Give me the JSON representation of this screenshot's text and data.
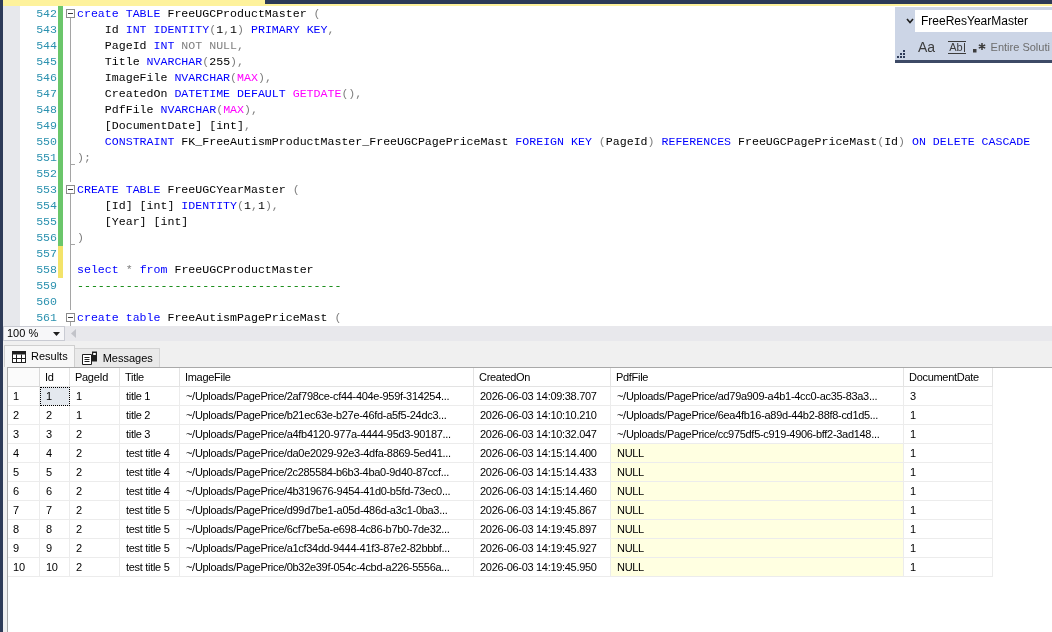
{
  "editor": {
    "lines": [
      {
        "number": "542",
        "color": "#6bc66b",
        "kind": "header",
        "tokens": [
          {
            "text": "create TABLE",
            "kind": "keyword"
          },
          {
            "text": " FreeUGCProductMaster ",
            "kind": "plain"
          },
          {
            "text": "(",
            "kind": "punct"
          }
        ]
      },
      {
        "number": "543",
        "color": "#6bc66b",
        "kind": "body",
        "tokens": [
          {
            "text": "    Id ",
            "kind": "plain"
          },
          {
            "text": "INT IDENTITY",
            "kind": "keyword"
          },
          {
            "text": "(",
            "kind": "punct"
          },
          {
            "text": "1",
            "kind": "plain"
          },
          {
            "text": ",",
            "kind": "punct"
          },
          {
            "text": "1",
            "kind": "plain"
          },
          {
            "text": ") ",
            "kind": "punct"
          },
          {
            "text": "PRIMARY KEY",
            "kind": "keyword"
          },
          {
            "text": ",",
            "kind": "punct"
          }
        ]
      },
      {
        "number": "544",
        "color": "#6bc66b",
        "kind": "body",
        "tokens": [
          {
            "text": "    PageId ",
            "kind": "plain"
          },
          {
            "text": "INT",
            "kind": "keyword"
          },
          {
            "text": " NOT NULL,",
            "kind": "punct"
          }
        ]
      },
      {
        "number": "545",
        "color": "#6bc66b",
        "kind": "body",
        "tokens": [
          {
            "text": "    Title ",
            "kind": "plain"
          },
          {
            "text": "NVARCHAR",
            "kind": "keyword"
          },
          {
            "text": "(",
            "kind": "punct"
          },
          {
            "text": "255",
            "kind": "plain"
          },
          {
            "text": "),",
            "kind": "punct"
          }
        ]
      },
      {
        "number": "546",
        "color": "#6bc66b",
        "kind": "body",
        "tokens": [
          {
            "text": "    ImageFile ",
            "kind": "plain"
          },
          {
            "text": "NVARCHAR",
            "kind": "keyword"
          },
          {
            "text": "(",
            "kind": "punct"
          },
          {
            "text": "MAX",
            "kind": "function"
          },
          {
            "text": "),",
            "kind": "punct"
          }
        ]
      },
      {
        "number": "547",
        "color": "#6bc66b",
        "kind": "body",
        "tokens": [
          {
            "text": "    CreatedOn ",
            "kind": "plain"
          },
          {
            "text": "DATETIME DEFAULT ",
            "kind": "keyword"
          },
          {
            "text": "GETDATE",
            "kind": "function"
          },
          {
            "text": "(),",
            "kind": "punct"
          }
        ]
      },
      {
        "number": "548",
        "color": "#6bc66b",
        "kind": "body",
        "tokens": [
          {
            "text": "    PdfFile ",
            "kind": "plain"
          },
          {
            "text": "NVARCHAR",
            "kind": "keyword"
          },
          {
            "text": "(",
            "kind": "punct"
          },
          {
            "text": "MAX",
            "kind": "function"
          },
          {
            "text": "),",
            "kind": "punct"
          }
        ]
      },
      {
        "number": "549",
        "color": "#6bc66b",
        "kind": "body",
        "tokens": [
          {
            "text": "    [DocumentDate] [int]",
            "kind": "plain"
          },
          {
            "text": ",",
            "kind": "punct"
          }
        ]
      },
      {
        "number": "550",
        "color": "#6bc66b",
        "kind": "body",
        "tokens": [
          {
            "text": "    CONSTRAINT",
            "kind": "keyword"
          },
          {
            "text": " FK_FreeAutismProductMaster_FreeUGCPagePriceMast ",
            "kind": "plain"
          },
          {
            "text": "FOREIGN KEY ",
            "kind": "keyword"
          },
          {
            "text": "(",
            "kind": "punct"
          },
          {
            "text": "PageId",
            "kind": "plain"
          },
          {
            "text": ") ",
            "kind": "punct"
          },
          {
            "text": "REFERENCES",
            "kind": "keyword"
          },
          {
            "text": " FreeUGCPagePriceMast",
            "kind": "plain"
          },
          {
            "text": "(",
            "kind": "punct"
          },
          {
            "text": "Id",
            "kind": "plain"
          },
          {
            "text": ") ",
            "kind": "punct"
          },
          {
            "text": "ON DELETE CASCADE",
            "kind": "keyword"
          }
        ]
      },
      {
        "number": "551",
        "color": "#6bc66b",
        "kind": "closer",
        "tokens": [
          {
            "text": ");",
            "kind": "punct"
          }
        ]
      },
      {
        "number": "552",
        "color": "#6bc66b",
        "kind": "body"
      },
      {
        "number": "553",
        "color": "#6bc66b",
        "kind": "header",
        "tokens": [
          {
            "text": "CREATE TABLE",
            "kind": "keyword"
          },
          {
            "text": " FreeUGCYearMaster ",
            "kind": "plain"
          },
          {
            "text": "(",
            "kind": "punct"
          }
        ]
      },
      {
        "number": "554",
        "color": "#6bc66b",
        "kind": "body",
        "tokens": [
          {
            "text": "    [Id] [int] ",
            "kind": "plain"
          },
          {
            "text": "IDENTITY",
            "kind": "keyword"
          },
          {
            "text": "(",
            "kind": "punct"
          },
          {
            "text": "1",
            "kind": "plain"
          },
          {
            "text": ",",
            "kind": "punct"
          },
          {
            "text": "1",
            "kind": "plain"
          },
          {
            "text": "),",
            "kind": "punct"
          }
        ]
      },
      {
        "number": "555",
        "color": "#6bc66b",
        "kind": "body",
        "tokens": [
          {
            "text": "    [Year] [int]",
            "kind": "plain"
          }
        ]
      },
      {
        "number": "556",
        "color": "#6bc66b",
        "kind": "closer",
        "tokens": [
          {
            "text": ")",
            "kind": "punct"
          }
        ]
      },
      {
        "number": "557",
        "color": "#f3e36a",
        "kind": "body"
      },
      {
        "number": "558",
        "color": "#f3e36a",
        "kind": "body",
        "tokens": [
          {
            "text": "select",
            "kind": "keyword"
          },
          {
            "text": " * ",
            "kind": "punct"
          },
          {
            "text": "from",
            "kind": "keyword"
          },
          {
            "text": " FreeUGCProductMaster",
            "kind": "plain"
          }
        ]
      },
      {
        "number": "559",
        "kind": "body",
        "tokens": [
          {
            "text": "--------------------------------------",
            "kind": "comment"
          }
        ]
      },
      {
        "number": "560",
        "kind": "body"
      },
      {
        "number": "561",
        "kind": "header",
        "tokens": [
          {
            "text": "create table",
            "kind": "keyword"
          },
          {
            "text": " FreeAutismPagePriceMast ",
            "kind": "plain"
          },
          {
            "text": "(",
            "kind": "punct"
          }
        ]
      }
    ]
  },
  "find_widget": {
    "query": "FreeResYearMaster",
    "match_case": "Aa",
    "whole_word": "Ab",
    "scope": "Entire Soluti"
  },
  "zoom": "100 %",
  "results": {
    "tabs": [
      {
        "kind": "grid",
        "label": "Results",
        "selected": true
      },
      {
        "kind": "messages",
        "label": "Messages",
        "selected": false
      }
    ],
    "columns": [
      "Id",
      "PageId",
      "Title",
      "ImageFile",
      "CreatedOn",
      "PdfFile",
      "DocumentDate"
    ],
    "rows": [
      {
        "number": "1",
        "cells": [
          {
            "text": "1",
            "kind": "value",
            "selected": true
          },
          {
            "text": "1",
            "kind": "value",
            "selected": false
          },
          {
            "text": "title 1",
            "kind": "value",
            "selected": false
          },
          {
            "text": "~/Uploads/PagePrice/2af798ce-cf44-404e-959f-314254...",
            "kind": "value",
            "selected": false
          },
          {
            "text": "2026-06-03 14:09:38.707",
            "kind": "value",
            "selected": false
          },
          {
            "text": "~/Uploads/PagePrice/ad79a909-a4b1-4cc0-ac35-83a3...",
            "kind": "value",
            "selected": false
          },
          {
            "text": "3",
            "kind": "value",
            "selected": false
          }
        ]
      },
      {
        "number": "2",
        "cells": [
          {
            "text": "2",
            "kind": "value",
            "selected": false
          },
          {
            "text": "1",
            "kind": "value",
            "selected": false
          },
          {
            "text": "title 2",
            "kind": "value",
            "selected": false
          },
          {
            "text": "~/Uploads/PagePrice/b21ec63e-b27e-46fd-a5f5-24dc3...",
            "kind": "value",
            "selected": false
          },
          {
            "text": "2026-06-03 14:10:10.210",
            "kind": "value",
            "selected": false
          },
          {
            "text": "~/Uploads/PagePrice/6ea4fb16-a89d-44b2-88f8-cd1d5...",
            "kind": "value",
            "selected": false
          },
          {
            "text": "1",
            "kind": "value",
            "selected": false
          }
        ]
      },
      {
        "number": "3",
        "cells": [
          {
            "text": "3",
            "kind": "value",
            "selected": false
          },
          {
            "text": "2",
            "kind": "value",
            "selected": false
          },
          {
            "text": "title 3",
            "kind": "value",
            "selected": false
          },
          {
            "text": "~/Uploads/PagePrice/a4fb4120-977a-4444-95d3-90187...",
            "kind": "value",
            "selected": false
          },
          {
            "text": "2026-06-03 14:10:32.047",
            "kind": "value",
            "selected": false
          },
          {
            "text": "~/Uploads/PagePrice/cc975df5-c919-4906-bff2-3ad148...",
            "kind": "value",
            "selected": false
          },
          {
            "text": "1",
            "kind": "value",
            "selected": false
          }
        ]
      },
      {
        "number": "4",
        "cells": [
          {
            "text": "4",
            "kind": "value",
            "selected": false
          },
          {
            "text": "2",
            "kind": "value",
            "selected": false
          },
          {
            "text": "test title 4",
            "kind": "value",
            "selected": false
          },
          {
            "text": "~/Uploads/PagePrice/da0e2029-92e3-4dfa-8869-5ed41...",
            "kind": "value",
            "selected": false
          },
          {
            "text": "2026-06-03 14:15:14.400",
            "kind": "value",
            "selected": false
          },
          {
            "text": "NULL",
            "kind": "null",
            "selected": false
          },
          {
            "text": "1",
            "kind": "value",
            "selected": false
          }
        ]
      },
      {
        "number": "5",
        "cells": [
          {
            "text": "5",
            "kind": "value",
            "selected": false
          },
          {
            "text": "2",
            "kind": "value",
            "selected": false
          },
          {
            "text": "test title 4",
            "kind": "value",
            "selected": false
          },
          {
            "text": "~/Uploads/PagePrice/2c285584-b6b3-4ba0-9d40-87ccf...",
            "kind": "value",
            "selected": false
          },
          {
            "text": "2026-06-03 14:15:14.433",
            "kind": "value",
            "selected": false
          },
          {
            "text": "NULL",
            "kind": "null",
            "selected": false
          },
          {
            "text": "1",
            "kind": "value",
            "selected": false
          }
        ]
      },
      {
        "number": "6",
        "cells": [
          {
            "text": "6",
            "kind": "value",
            "selected": false
          },
          {
            "text": "2",
            "kind": "value",
            "selected": false
          },
          {
            "text": "test title 4",
            "kind": "value",
            "selected": false
          },
          {
            "text": "~/Uploads/PagePrice/4b319676-9454-41d0-b5fd-73ec0...",
            "kind": "value",
            "selected": false
          },
          {
            "text": "2026-06-03 14:15:14.460",
            "kind": "value",
            "selected": false
          },
          {
            "text": "NULL",
            "kind": "null",
            "selected": false
          },
          {
            "text": "1",
            "kind": "value",
            "selected": false
          }
        ]
      },
      {
        "number": "7",
        "cells": [
          {
            "text": "7",
            "kind": "value",
            "selected": false
          },
          {
            "text": "2",
            "kind": "value",
            "selected": false
          },
          {
            "text": "test title 5",
            "kind": "value",
            "selected": false
          },
          {
            "text": "~/Uploads/PagePrice/d99d7be1-a05d-486d-a3c1-0ba3...",
            "kind": "value",
            "selected": false
          },
          {
            "text": "2026-06-03 14:19:45.867",
            "kind": "value",
            "selected": false
          },
          {
            "text": "NULL",
            "kind": "null",
            "selected": false
          },
          {
            "text": "1",
            "kind": "value",
            "selected": false
          }
        ]
      },
      {
        "number": "8",
        "cells": [
          {
            "text": "8",
            "kind": "value",
            "selected": false
          },
          {
            "text": "2",
            "kind": "value",
            "selected": false
          },
          {
            "text": "test title 5",
            "kind": "value",
            "selected": false
          },
          {
            "text": "~/Uploads/PagePrice/6cf7be5a-e698-4c86-b7b0-7de32...",
            "kind": "value",
            "selected": false
          },
          {
            "text": "2026-06-03 14:19:45.897",
            "kind": "value",
            "selected": false
          },
          {
            "text": "NULL",
            "kind": "null",
            "selected": false
          },
          {
            "text": "1",
            "kind": "value",
            "selected": false
          }
        ]
      },
      {
        "number": "9",
        "cells": [
          {
            "text": "9",
            "kind": "value",
            "selected": false
          },
          {
            "text": "2",
            "kind": "value",
            "selected": false
          },
          {
            "text": "test title 5",
            "kind": "value",
            "selected": false
          },
          {
            "text": "~/Uploads/PagePrice/a1cf34dd-9444-41f3-87e2-82bbbf...",
            "kind": "value",
            "selected": false
          },
          {
            "text": "2026-06-03 14:19:45.927",
            "kind": "value",
            "selected": false
          },
          {
            "text": "NULL",
            "kind": "null",
            "selected": false
          },
          {
            "text": "1",
            "kind": "value",
            "selected": false
          }
        ]
      },
      {
        "number": "10",
        "cells": [
          {
            "text": "10",
            "kind": "value",
            "selected": false
          },
          {
            "text": "2",
            "kind": "value",
            "selected": false
          },
          {
            "text": "test title 5",
            "kind": "value",
            "selected": false
          },
          {
            "text": "~/Uploads/PagePrice/0b32e39f-054c-4cbd-a226-5556a...",
            "kind": "value",
            "selected": false
          },
          {
            "text": "2026-06-03 14:19:45.950",
            "kind": "value",
            "selected": false
          },
          {
            "text": "NULL",
            "kind": "null",
            "selected": false
          },
          {
            "text": "1",
            "kind": "value",
            "selected": false
          }
        ]
      }
    ]
  }
}
